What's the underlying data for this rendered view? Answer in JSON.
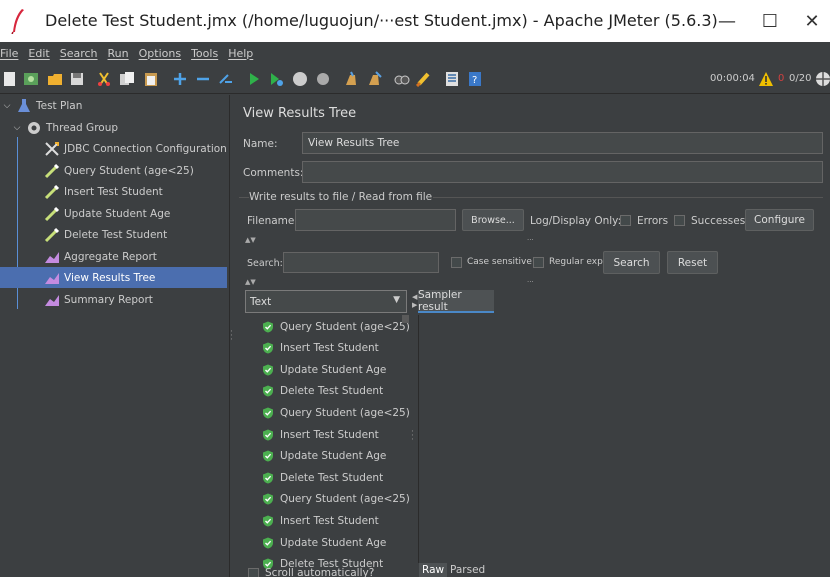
{
  "window": {
    "title": "Delete Test Student.jmx (/home/luguojun/···est Student.jmx) - Apache JMeter (5.6.3)",
    "minimize": "—",
    "maximize": "☐",
    "close": "✕"
  },
  "menu": {
    "items": [
      "File",
      "Edit",
      "Search",
      "Run",
      "Options",
      "Tools",
      "Help"
    ]
  },
  "toolbar": {
    "timer": "00:00:04",
    "error_count": "0",
    "threads": "0/20",
    "icons": [
      "new-icon",
      "templates-icon",
      "open-icon",
      "save-icon",
      "cut-icon",
      "copy-icon",
      "paste-icon",
      "expand-icon",
      "collapse-icon",
      "toggle-icon",
      "start-icon",
      "start-no-pauses-icon",
      "stop-icon",
      "shutdown-icon",
      "clear-icon",
      "clear-all-icon",
      "search-icon",
      "reset-search-icon",
      "function-helper-icon",
      "help-icon"
    ]
  },
  "tree": {
    "items": [
      {
        "label": "Test Plan",
        "icon": "flask-icon",
        "level": 0,
        "expanded": true
      },
      {
        "label": "Thread Group",
        "icon": "gear-icon",
        "level": 1,
        "expanded": true
      },
      {
        "label": "JDBC Connection Configuration",
        "icon": "wrench-icon",
        "level": 2
      },
      {
        "label": "Query Student (age<25)",
        "icon": "pipette-icon",
        "level": 2
      },
      {
        "label": "Insert Test Student",
        "icon": "pipette-icon",
        "level": 2
      },
      {
        "label": "Update Student Age",
        "icon": "pipette-icon",
        "level": 2
      },
      {
        "label": "Delete Test Student",
        "icon": "pipette-icon",
        "level": 2
      },
      {
        "label": "Aggregate Report",
        "icon": "chart-icon",
        "level": 2
      },
      {
        "label": "View Results Tree",
        "icon": "chart-icon",
        "level": 2,
        "selected": true
      },
      {
        "label": "Summary Report",
        "icon": "chart-icon",
        "level": 2
      }
    ]
  },
  "panel": {
    "title": "View Results Tree",
    "name_label": "Name:",
    "name_value": "View Results Tree",
    "comments_label": "Comments:",
    "comments_value": "",
    "write_results_legend": "Write results to file / Read from file",
    "filename_label": "Filename",
    "filename_value": "",
    "browse_button": "Browse...",
    "log_display_label": "Log/Display Only:",
    "errors_label": "Errors",
    "successes_label": "Successes",
    "configure_button": "Configure",
    "search_label": "Search:",
    "search_value": "",
    "case_sensitive_label": "Case sensitive",
    "regex_label": "Regular exp.",
    "search_button": "Search",
    "reset_button": "Reset",
    "renderer_selected": "Text",
    "sampler_result_tab": "Sampler result",
    "scroll_auto_label": "Scroll automatically?",
    "raw_tab": "Raw",
    "parsed_tab": "Parsed"
  },
  "results": [
    "Query Student (age<25)",
    "Insert Test Student",
    "Update Student Age",
    "Delete Test Student",
    "Query Student (age<25)",
    "Insert Test Student",
    "Update Student Age",
    "Delete Test Student",
    "Query Student (age<25)",
    "Insert Test Student",
    "Update Student Age",
    "Delete Test Student"
  ],
  "colors": {
    "background": "#3c3f41",
    "selection": "#4b6eaf",
    "success": "#4caf50",
    "warning": "#f0c000"
  }
}
